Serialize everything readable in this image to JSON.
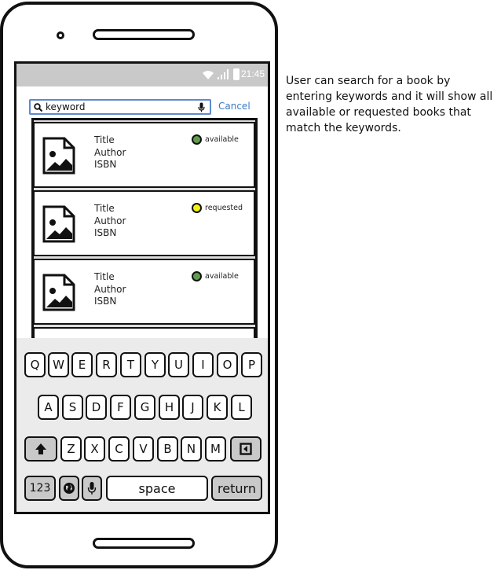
{
  "status_bar": {
    "time": "21:45"
  },
  "search": {
    "keyword": "keyword",
    "cancel_label": "Cancel"
  },
  "results": [
    {
      "title": "Title",
      "author": "Author",
      "isbn": "ISBN",
      "status": "available",
      "status_color": "#5e9e4a"
    },
    {
      "title": "Title",
      "author": "Author",
      "isbn": "ISBN",
      "status": "requested",
      "status_color": "#f2f20f"
    },
    {
      "title": "Title",
      "author": "Author",
      "isbn": "ISBN",
      "status": "available",
      "status_color": "#5e9e4a"
    }
  ],
  "keyboard": {
    "row1": [
      "Q",
      "W",
      "E",
      "R",
      "T",
      "Y",
      "U",
      "I",
      "O",
      "P"
    ],
    "row2": [
      "A",
      "S",
      "D",
      "F",
      "G",
      "H",
      "J",
      "K",
      "L"
    ],
    "row3": [
      "Z",
      "X",
      "C",
      "V",
      "B",
      "N",
      "M"
    ],
    "numbers_label": "123",
    "space_label": "space",
    "return_label": "return"
  },
  "description": "User can search for a book by entering keywords and it will show all available or requested books that match the keywords."
}
